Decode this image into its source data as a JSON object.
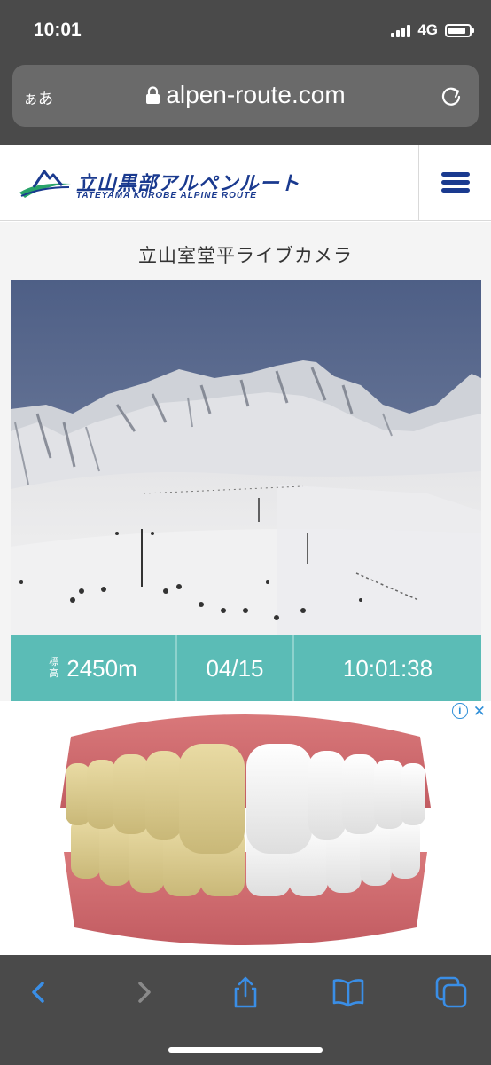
{
  "status_bar": {
    "time": "10:01",
    "network": "4G",
    "battery_level": 0.85
  },
  "browser": {
    "aa_label": "ぁあ",
    "url": "alpen-route.com",
    "icons": [
      "lock-icon",
      "reload-icon",
      "back-icon",
      "forward-icon",
      "share-icon",
      "bookmarks-icon",
      "tabs-icon"
    ],
    "accent_color": "#3a8ee6"
  },
  "site": {
    "logo_text": "立山黒部アルペンルート",
    "logo_subtext": "TATEYAMA KUROBE ALPINE ROUTE",
    "brand_color": "#1a3a8f"
  },
  "camera": {
    "title": "立山室堂平ライブカメラ",
    "elevation_label": "標高",
    "elevation": "2450m",
    "date": "04/15",
    "time": "10:01:38",
    "info_color": "#5bbcb6"
  },
  "ad": {
    "info_symbol": "i",
    "close_symbol": "✕"
  }
}
